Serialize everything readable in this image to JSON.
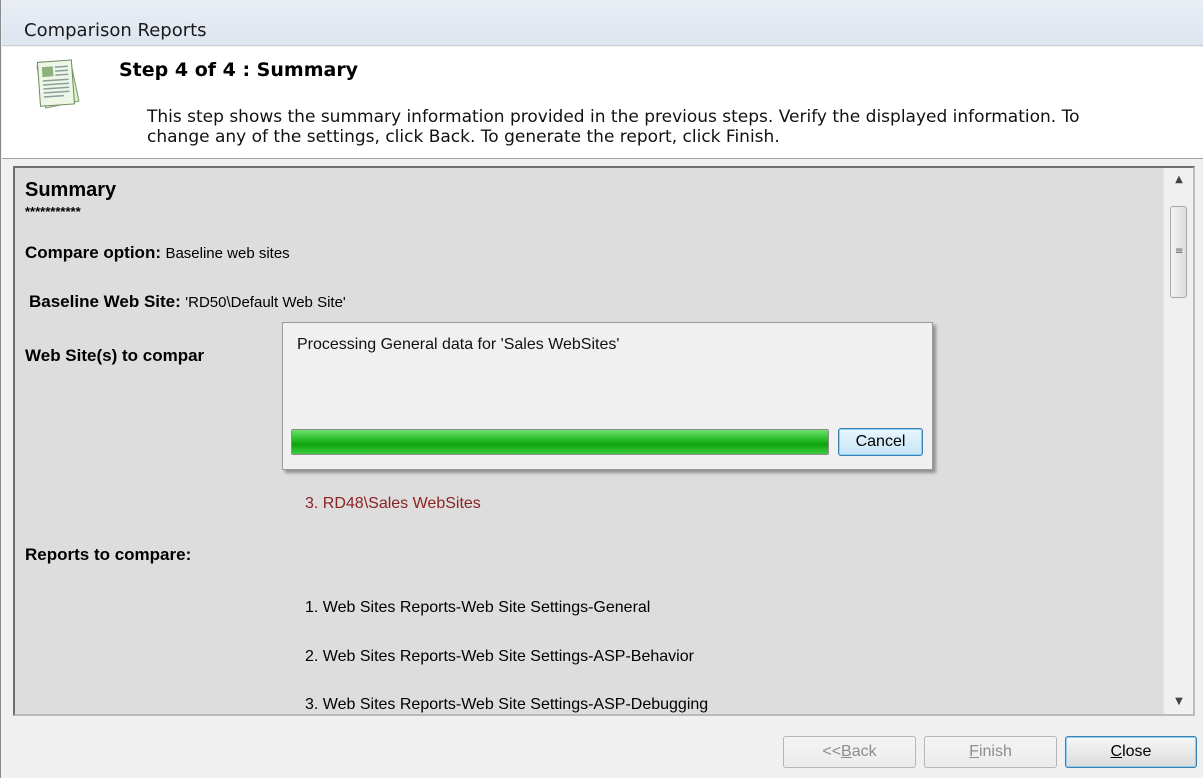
{
  "window": {
    "title": "Comparison Reports"
  },
  "header": {
    "icon": "report-pages-icon",
    "step_title": "Step 4 of 4 : Summary",
    "description": "This step shows the summary information provided in the previous steps. Verify the displayed information. To change any of the settings, click Back. To generate the report, click Finish."
  },
  "summary": {
    "heading": "Summary",
    "stars": "***********",
    "compare_option_label": "Compare option:",
    "compare_option_value": "Baseline web sites",
    "baseline_label": "Baseline  Web Site:",
    "baseline_value": "'RD50\\Default Web Site'",
    "sites_label": "Web Site(s) to compar",
    "site_item_3": "3. RD48\\Sales WebSites",
    "reports_label": "Reports to compare:",
    "reports": [
      "1. Web Sites Reports-Web Site Settings-General",
      "2. Web Sites Reports-Web Site Settings-ASP-Behavior",
      "3. Web Sites Reports-Web Site Settings-ASP-Debugging"
    ]
  },
  "progress_dialog": {
    "message": "Processing General data for 'Sales WebSites'",
    "progress": 1.0,
    "cancel_label": "Cancel"
  },
  "footer": {
    "back_prefix": "<<",
    "back_key": "B",
    "back_rest": "ack",
    "finish_key": "F",
    "finish_rest": "inish",
    "close_key": "C",
    "close_rest": "lose"
  },
  "colors": {
    "link_red": "#8b2323",
    "progress_green": "#1fb21f",
    "focus_blue": "#3c7fb1"
  }
}
